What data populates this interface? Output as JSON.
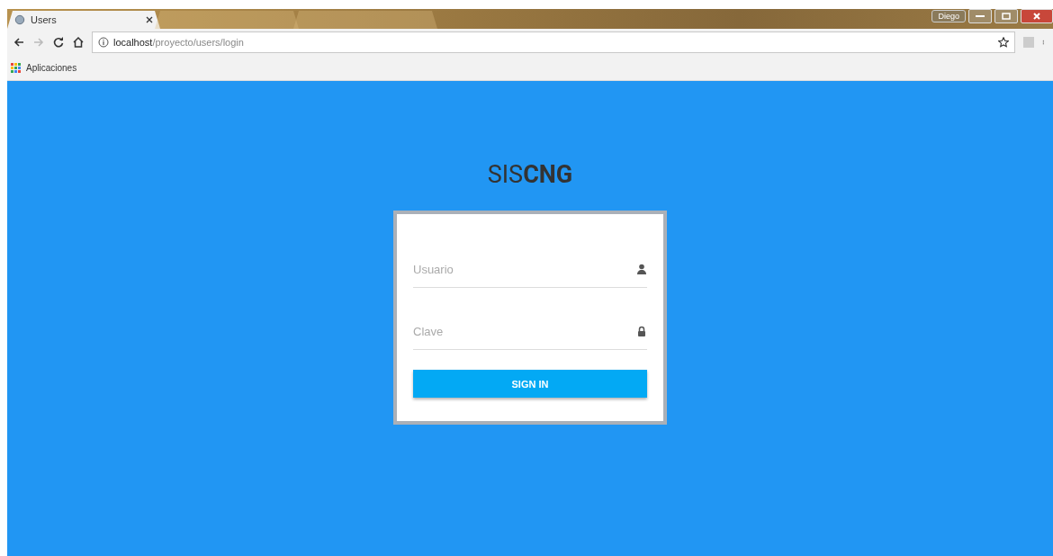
{
  "browser": {
    "tabs": [
      {
        "title": "Users",
        "selected": true
      },
      {
        "selected": false
      },
      {
        "selected": false
      }
    ],
    "profile": "Diego",
    "url_host": "localhost",
    "url_path": "/proyecto/users/login",
    "bookmarks": [
      "Aplicaciones"
    ]
  },
  "page": {
    "title": "SIS**CNG**",
    "fields": [
      {
        "placeholder": "Usuario",
        "kind": "user"
      },
      {
        "placeholder": "Clave",
        "kind": "password"
      }
    ],
    "button": "SIGN IN"
  }
}
